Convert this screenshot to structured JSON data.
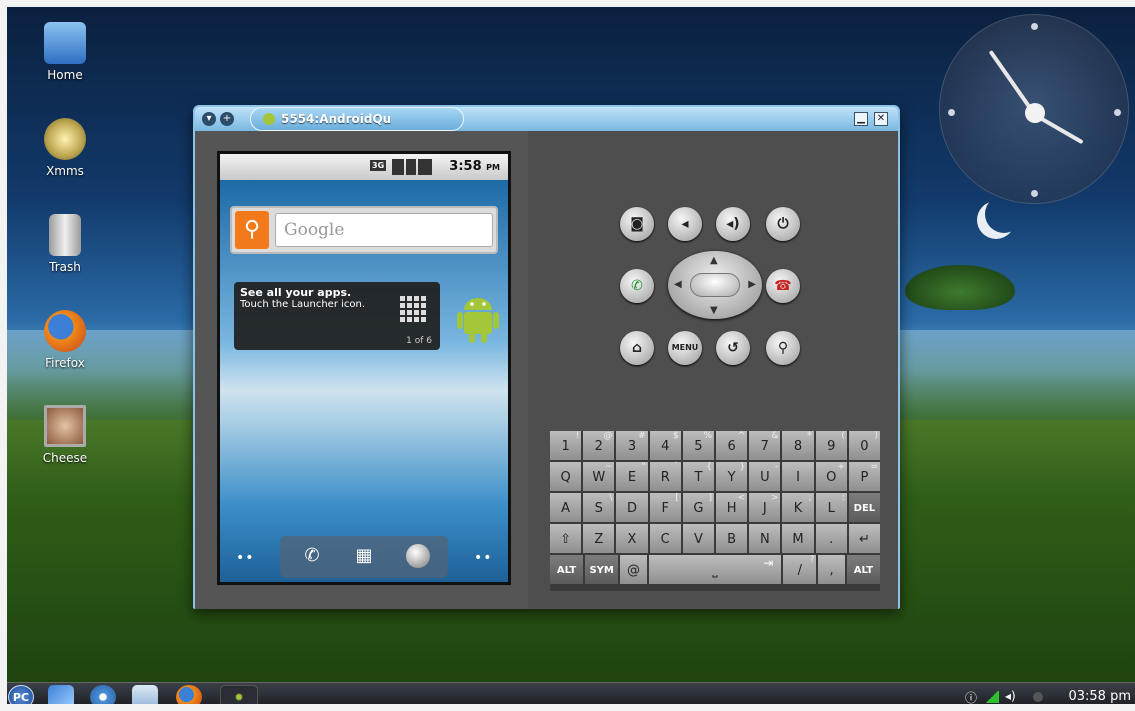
{
  "desktop": {
    "icons": [
      {
        "label": "Home",
        "icon": "home-folder-icon",
        "color": "#3d7fd1"
      },
      {
        "label": "Xmms",
        "icon": "xmms-player-icon",
        "color": "#d2c27a"
      },
      {
        "label": "Trash",
        "icon": "trash-can-icon",
        "color": "#c8c8c8"
      },
      {
        "label": "Firefox",
        "icon": "firefox-icon",
        "color": "#e26b14"
      },
      {
        "label": "Cheese",
        "icon": "cheese-webcam-icon",
        "color": "#8a5a3a"
      }
    ]
  },
  "window": {
    "title": "5554:AndroidQu",
    "accent": "#8ec3e8"
  },
  "phone": {
    "status": {
      "time": "3:58",
      "ampm": "PM",
      "network": "3G"
    },
    "search": {
      "placeholder": "Google"
    },
    "tip": {
      "title": "See all your apps.",
      "body": "Touch the Launcher icon.",
      "page": "1 of 6"
    },
    "dock": {
      "phone": "phone-icon",
      "launcher": "launcher-grid-icon",
      "browser": "browser-globe-icon"
    }
  },
  "controls": {
    "row1": [
      "camera-icon",
      "volume-down-icon",
      "volume-up-icon",
      "power-icon"
    ],
    "call_icon": "call-icon",
    "endcall_icon": "end-call-icon",
    "home_icon": "home-icon",
    "menu_label": "MENU",
    "back_icon": "back-icon",
    "search_icon": "search-icon"
  },
  "keyboard": {
    "row1": [
      [
        "1",
        "!"
      ],
      [
        "2",
        "@"
      ],
      [
        "3",
        "#"
      ],
      [
        "4",
        "$"
      ],
      [
        "5",
        "%"
      ],
      [
        "6",
        "^"
      ],
      [
        "7",
        "&"
      ],
      [
        "8",
        "*"
      ],
      [
        "9",
        "("
      ],
      [
        "0",
        ")"
      ]
    ],
    "row2": [
      [
        "Q",
        ""
      ],
      [
        "W",
        "~"
      ],
      [
        "E",
        "\""
      ],
      [
        "R",
        "`"
      ],
      [
        "T",
        "{"
      ],
      [
        "Y",
        "}"
      ],
      [
        "U",
        "-"
      ],
      [
        "I",
        ""
      ],
      [
        "O",
        "+"
      ],
      [
        "P",
        "="
      ]
    ],
    "row3": [
      [
        "A",
        ""
      ],
      [
        "S",
        "\\"
      ],
      [
        "D",
        ""
      ],
      [
        "F",
        "["
      ],
      [
        "G",
        "]"
      ],
      [
        "H",
        "<"
      ],
      [
        "J",
        ">"
      ],
      [
        "K",
        ";"
      ],
      [
        "L",
        ":"
      ],
      [
        "DEL",
        ""
      ]
    ],
    "row4": [
      [
        "⇧",
        ""
      ],
      [
        "Z",
        ""
      ],
      [
        "X",
        ""
      ],
      [
        "C",
        ""
      ],
      [
        "V",
        ""
      ],
      [
        "B",
        ""
      ],
      [
        "N",
        ""
      ],
      [
        "M",
        ""
      ],
      [
        ".",
        ""
      ],
      [
        "↵",
        ""
      ]
    ],
    "row5": {
      "alt": "ALT",
      "sym": "SYM",
      "at": "@",
      "space": "⎵",
      "tab": "⇥",
      "slash": "/",
      "slash_sub": "?",
      "comma": ",",
      "alt2": "ALT"
    }
  },
  "taskbar": {
    "start": "PC",
    "clock": "03:58 pm"
  }
}
